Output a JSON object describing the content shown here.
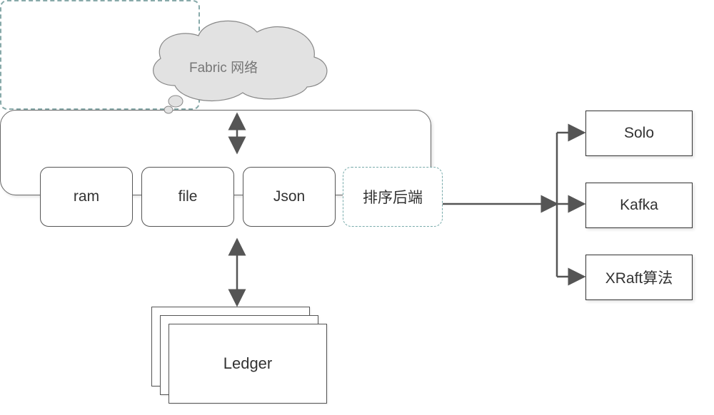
{
  "chart_data": {
    "type": "diagram",
    "title": "",
    "nodes": [
      {
        "id": "fabric_network",
        "label": "Fabric  网络",
        "kind": "cloud",
        "style": "dashed"
      },
      {
        "id": "orderer",
        "label": "",
        "kind": "container",
        "children": [
          "ram",
          "file",
          "json",
          "sort_backend"
        ]
      },
      {
        "id": "ram",
        "label": "ram",
        "kind": "module"
      },
      {
        "id": "file",
        "label": "file",
        "kind": "module"
      },
      {
        "id": "json",
        "label": "Json",
        "kind": "module"
      },
      {
        "id": "sort_backend",
        "label": "排序后端",
        "kind": "module",
        "style": "dashed"
      },
      {
        "id": "ledger",
        "label": "Ledger",
        "kind": "stack",
        "count": 3
      },
      {
        "id": "solo",
        "label": "Solo",
        "kind": "option"
      },
      {
        "id": "kafka",
        "label": "Kafka",
        "kind": "option"
      },
      {
        "id": "xraft",
        "label": "XRaft算法",
        "kind": "option"
      }
    ],
    "edges": [
      {
        "from": "fabric_network",
        "to": "orderer",
        "dir": "both"
      },
      {
        "from": "orderer",
        "to": "ledger",
        "dir": "both"
      },
      {
        "from": "sort_backend",
        "to": "solo",
        "dir": "forward"
      },
      {
        "from": "sort_backend",
        "to": "kafka",
        "dir": "forward"
      },
      {
        "from": "sort_backend",
        "to": "xraft",
        "dir": "forward"
      }
    ]
  },
  "cloud": {
    "label": "Fabric  网络"
  },
  "orderer": {
    "modules": {
      "ram": "ram",
      "file": "file",
      "json": "Json",
      "sort": "排序后端"
    }
  },
  "ledger": {
    "label": "Ledger"
  },
  "options": {
    "solo": "Solo",
    "kafka": "Kafka",
    "xraft": "XRaft算法"
  }
}
